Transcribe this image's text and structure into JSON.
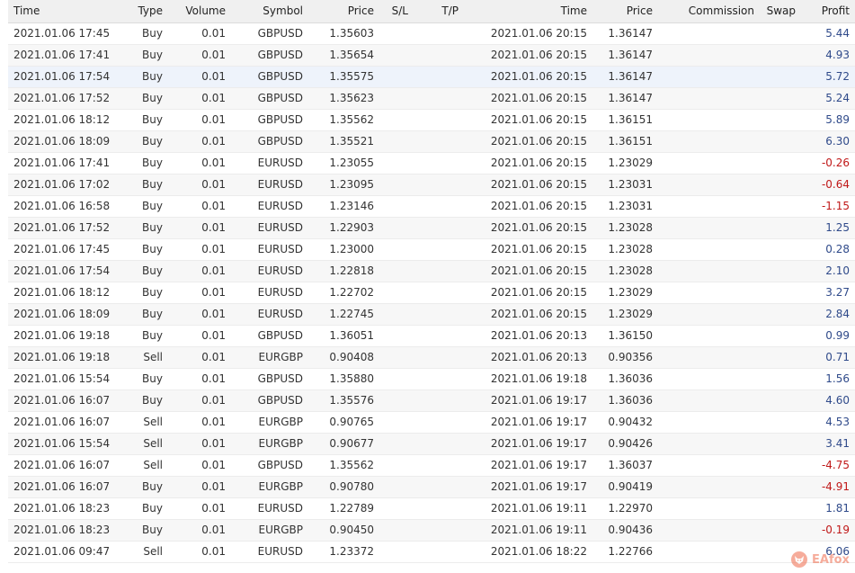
{
  "columns": [
    "Time",
    "Type",
    "Volume",
    "Symbol",
    "Price",
    "S/L",
    "T/P",
    "Time",
    "Price",
    "Commission",
    "Swap",
    "Profit"
  ],
  "rows": [
    {
      "open_time": "2021.01.06 17:45",
      "type": "Buy",
      "volume": "0.01",
      "symbol": "GBPUSD",
      "open_price": "1.35603",
      "sl": "",
      "tp": "",
      "close_time": "2021.01.06 20:15",
      "close_price": "1.36147",
      "commission": "",
      "swap": "",
      "profit": "5.44"
    },
    {
      "open_time": "2021.01.06 17:41",
      "type": "Buy",
      "volume": "0.01",
      "symbol": "GBPUSD",
      "open_price": "1.35654",
      "sl": "",
      "tp": "",
      "close_time": "2021.01.06 20:15",
      "close_price": "1.36147",
      "commission": "",
      "swap": "",
      "profit": "4.93"
    },
    {
      "open_time": "2021.01.06 17:54",
      "type": "Buy",
      "volume": "0.01",
      "symbol": "GBPUSD",
      "open_price": "1.35575",
      "sl": "",
      "tp": "",
      "close_time": "2021.01.06 20:15",
      "close_price": "1.36147",
      "commission": "",
      "swap": "",
      "profit": "5.72"
    },
    {
      "open_time": "2021.01.06 17:52",
      "type": "Buy",
      "volume": "0.01",
      "symbol": "GBPUSD",
      "open_price": "1.35623",
      "sl": "",
      "tp": "",
      "close_time": "2021.01.06 20:15",
      "close_price": "1.36147",
      "commission": "",
      "swap": "",
      "profit": "5.24"
    },
    {
      "open_time": "2021.01.06 18:12",
      "type": "Buy",
      "volume": "0.01",
      "symbol": "GBPUSD",
      "open_price": "1.35562",
      "sl": "",
      "tp": "",
      "close_time": "2021.01.06 20:15",
      "close_price": "1.36151",
      "commission": "",
      "swap": "",
      "profit": "5.89"
    },
    {
      "open_time": "2021.01.06 18:09",
      "type": "Buy",
      "volume": "0.01",
      "symbol": "GBPUSD",
      "open_price": "1.35521",
      "sl": "",
      "tp": "",
      "close_time": "2021.01.06 20:15",
      "close_price": "1.36151",
      "commission": "",
      "swap": "",
      "profit": "6.30"
    },
    {
      "open_time": "2021.01.06 17:41",
      "type": "Buy",
      "volume": "0.01",
      "symbol": "EURUSD",
      "open_price": "1.23055",
      "sl": "",
      "tp": "",
      "close_time": "2021.01.06 20:15",
      "close_price": "1.23029",
      "commission": "",
      "swap": "",
      "profit": "-0.26"
    },
    {
      "open_time": "2021.01.06 17:02",
      "type": "Buy",
      "volume": "0.01",
      "symbol": "EURUSD",
      "open_price": "1.23095",
      "sl": "",
      "tp": "",
      "close_time": "2021.01.06 20:15",
      "close_price": "1.23031",
      "commission": "",
      "swap": "",
      "profit": "-0.64"
    },
    {
      "open_time": "2021.01.06 16:58",
      "type": "Buy",
      "volume": "0.01",
      "symbol": "EURUSD",
      "open_price": "1.23146",
      "sl": "",
      "tp": "",
      "close_time": "2021.01.06 20:15",
      "close_price": "1.23031",
      "commission": "",
      "swap": "",
      "profit": "-1.15"
    },
    {
      "open_time": "2021.01.06 17:52",
      "type": "Buy",
      "volume": "0.01",
      "symbol": "EURUSD",
      "open_price": "1.22903",
      "sl": "",
      "tp": "",
      "close_time": "2021.01.06 20:15",
      "close_price": "1.23028",
      "commission": "",
      "swap": "",
      "profit": "1.25"
    },
    {
      "open_time": "2021.01.06 17:45",
      "type": "Buy",
      "volume": "0.01",
      "symbol": "EURUSD",
      "open_price": "1.23000",
      "sl": "",
      "tp": "",
      "close_time": "2021.01.06 20:15",
      "close_price": "1.23028",
      "commission": "",
      "swap": "",
      "profit": "0.28"
    },
    {
      "open_time": "2021.01.06 17:54",
      "type": "Buy",
      "volume": "0.01",
      "symbol": "EURUSD",
      "open_price": "1.22818",
      "sl": "",
      "tp": "",
      "close_time": "2021.01.06 20:15",
      "close_price": "1.23028",
      "commission": "",
      "swap": "",
      "profit": "2.10"
    },
    {
      "open_time": "2021.01.06 18:12",
      "type": "Buy",
      "volume": "0.01",
      "symbol": "EURUSD",
      "open_price": "1.22702",
      "sl": "",
      "tp": "",
      "close_time": "2021.01.06 20:15",
      "close_price": "1.23029",
      "commission": "",
      "swap": "",
      "profit": "3.27"
    },
    {
      "open_time": "2021.01.06 18:09",
      "type": "Buy",
      "volume": "0.01",
      "symbol": "EURUSD",
      "open_price": "1.22745",
      "sl": "",
      "tp": "",
      "close_time": "2021.01.06 20:15",
      "close_price": "1.23029",
      "commission": "",
      "swap": "",
      "profit": "2.84"
    },
    {
      "open_time": "2021.01.06 19:18",
      "type": "Buy",
      "volume": "0.01",
      "symbol": "GBPUSD",
      "open_price": "1.36051",
      "sl": "",
      "tp": "",
      "close_time": "2021.01.06 20:13",
      "close_price": "1.36150",
      "commission": "",
      "swap": "",
      "profit": "0.99"
    },
    {
      "open_time": "2021.01.06 19:18",
      "type": "Sell",
      "volume": "0.01",
      "symbol": "EURGBP",
      "open_price": "0.90408",
      "sl": "",
      "tp": "",
      "close_time": "2021.01.06 20:13",
      "close_price": "0.90356",
      "commission": "",
      "swap": "",
      "profit": "0.71"
    },
    {
      "open_time": "2021.01.06 15:54",
      "type": "Buy",
      "volume": "0.01",
      "symbol": "GBPUSD",
      "open_price": "1.35880",
      "sl": "",
      "tp": "",
      "close_time": "2021.01.06 19:18",
      "close_price": "1.36036",
      "commission": "",
      "swap": "",
      "profit": "1.56"
    },
    {
      "open_time": "2021.01.06 16:07",
      "type": "Buy",
      "volume": "0.01",
      "symbol": "GBPUSD",
      "open_price": "1.35576",
      "sl": "",
      "tp": "",
      "close_time": "2021.01.06 19:17",
      "close_price": "1.36036",
      "commission": "",
      "swap": "",
      "profit": "4.60"
    },
    {
      "open_time": "2021.01.06 16:07",
      "type": "Sell",
      "volume": "0.01",
      "symbol": "EURGBP",
      "open_price": "0.90765",
      "sl": "",
      "tp": "",
      "close_time": "2021.01.06 19:17",
      "close_price": "0.90432",
      "commission": "",
      "swap": "",
      "profit": "4.53"
    },
    {
      "open_time": "2021.01.06 15:54",
      "type": "Sell",
      "volume": "0.01",
      "symbol": "EURGBP",
      "open_price": "0.90677",
      "sl": "",
      "tp": "",
      "close_time": "2021.01.06 19:17",
      "close_price": "0.90426",
      "commission": "",
      "swap": "",
      "profit": "3.41"
    },
    {
      "open_time": "2021.01.06 16:07",
      "type": "Sell",
      "volume": "0.01",
      "symbol": "GBPUSD",
      "open_price": "1.35562",
      "sl": "",
      "tp": "",
      "close_time": "2021.01.06 19:17",
      "close_price": "1.36037",
      "commission": "",
      "swap": "",
      "profit": "-4.75"
    },
    {
      "open_time": "2021.01.06 16:07",
      "type": "Buy",
      "volume": "0.01",
      "symbol": "EURGBP",
      "open_price": "0.90780",
      "sl": "",
      "tp": "",
      "close_time": "2021.01.06 19:17",
      "close_price": "0.90419",
      "commission": "",
      "swap": "",
      "profit": "-4.91"
    },
    {
      "open_time": "2021.01.06 18:23",
      "type": "Buy",
      "volume": "0.01",
      "symbol": "EURUSD",
      "open_price": "1.22789",
      "sl": "",
      "tp": "",
      "close_time": "2021.01.06 19:11",
      "close_price": "1.22970",
      "commission": "",
      "swap": "",
      "profit": "1.81"
    },
    {
      "open_time": "2021.01.06 18:23",
      "type": "Buy",
      "volume": "0.01",
      "symbol": "EURGBP",
      "open_price": "0.90450",
      "sl": "",
      "tp": "",
      "close_time": "2021.01.06 19:11",
      "close_price": "0.90436",
      "commission": "",
      "swap": "",
      "profit": "-0.19"
    },
    {
      "open_time": "2021.01.06 09:47",
      "type": "Sell",
      "volume": "0.01",
      "symbol": "EURUSD",
      "open_price": "1.23372",
      "sl": "",
      "tp": "",
      "close_time": "2021.01.06 18:22",
      "close_price": "1.22766",
      "commission": "",
      "swap": "",
      "profit": "6.06"
    }
  ],
  "highlighted_row": 2,
  "watermark": {
    "text": "EAfox",
    "icon": "fox-logo-icon",
    "color": "#ef6a4a"
  },
  "colors": {
    "profit_positive": "#2f4a8a",
    "profit_negative": "#c01818",
    "header_bg": "#f0f0f0"
  }
}
